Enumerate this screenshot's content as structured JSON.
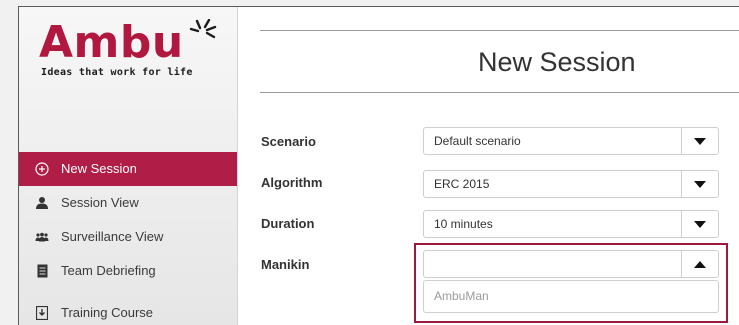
{
  "brand": {
    "name": "Ambu",
    "tagline": "Ideas that work for life",
    "color": "#b0183f"
  },
  "sidebar": {
    "items": [
      {
        "label": "New Session",
        "icon": "plus-circle-icon",
        "active": true
      },
      {
        "label": "Session View",
        "icon": "person-icon",
        "active": false
      },
      {
        "label": "Surveillance View",
        "icon": "group-icon",
        "active": false
      },
      {
        "label": "Team Debriefing",
        "icon": "document-icon",
        "active": false
      },
      {
        "label": "Training Course",
        "icon": "download-icon",
        "active": false
      }
    ]
  },
  "main": {
    "title": "New Session",
    "fields": [
      {
        "label": "Scenario",
        "value": "Default scenario",
        "placeholder": ""
      },
      {
        "label": "Algorithm",
        "value": "ERC 2015",
        "placeholder": ""
      },
      {
        "label": "Duration",
        "value": "10 minutes",
        "placeholder": ""
      },
      {
        "label": "Manikin",
        "value": "",
        "placeholder": ""
      }
    ],
    "manikin_options": [
      "AmbuMan"
    ]
  },
  "colors": {
    "active_nav": "#b01d47",
    "highlight_border": "#9c1a3e"
  }
}
